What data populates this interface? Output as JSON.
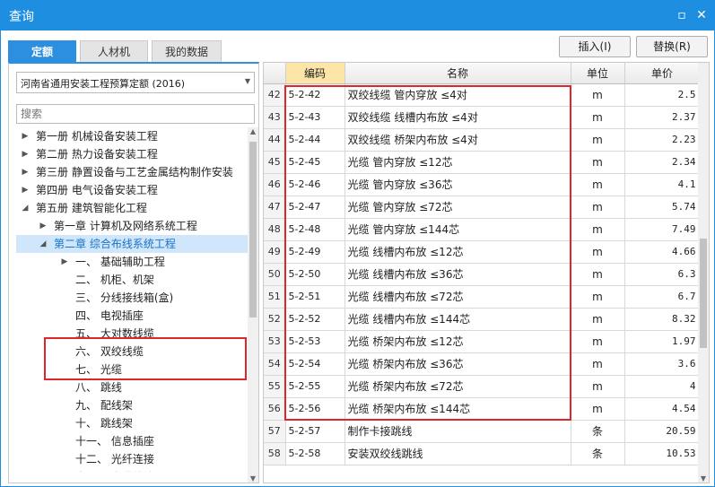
{
  "window": {
    "title": "查询"
  },
  "tabs": [
    {
      "label": "定额",
      "active": true
    },
    {
      "label": "人材机",
      "active": false
    },
    {
      "label": "我的数据",
      "active": false
    }
  ],
  "toolbar": {
    "insert_label": "插入(I)",
    "replace_label": "替换(R)"
  },
  "left": {
    "quota_select": "河南省通用安装工程预算定额 (2016)",
    "search_placeholder": "搜索",
    "tree": [
      {
        "label": "第一册  机械设备安装工程",
        "level": 0,
        "arrow": "right"
      },
      {
        "label": "第二册  热力设备安装工程",
        "level": 0,
        "arrow": "right"
      },
      {
        "label": "第三册  静置设备与工艺金属结构制作安装",
        "level": 0,
        "arrow": "right"
      },
      {
        "label": "第四册  电气设备安装工程",
        "level": 0,
        "arrow": "right"
      },
      {
        "label": "第五册  建筑智能化工程",
        "level": 0,
        "arrow": "down"
      },
      {
        "label": "第一章  计算机及网络系统工程",
        "level": 1,
        "arrow": "right"
      },
      {
        "label": "第二章  综合布线系统工程",
        "level": 1,
        "arrow": "down",
        "selected": true
      },
      {
        "label": "一、  基础辅助工程",
        "level": 2,
        "arrow": "right"
      },
      {
        "label": "二、  机柜、机架",
        "level": 2,
        "arrow": ""
      },
      {
        "label": "三、  分线接线箱(盒)",
        "level": 2,
        "arrow": ""
      },
      {
        "label": "四、  电视插座",
        "level": 2,
        "arrow": ""
      },
      {
        "label": "五、  大对数线缆",
        "level": 2,
        "arrow": ""
      },
      {
        "label": "六、  双绞线缆",
        "level": 2,
        "arrow": ""
      },
      {
        "label": "七、  光缆",
        "level": 2,
        "arrow": ""
      },
      {
        "label": "八、  跳线",
        "level": 2,
        "arrow": ""
      },
      {
        "label": "九、  配线架",
        "level": 2,
        "arrow": ""
      },
      {
        "label": "十、  跳线架",
        "level": 2,
        "arrow": ""
      },
      {
        "label": "十一、  信息插座",
        "level": 2,
        "arrow": ""
      },
      {
        "label": "十二、  光纤连接",
        "level": 2,
        "arrow": ""
      },
      {
        "label": "十三、  光缆终端盒",
        "level": 2,
        "arrow": ""
      }
    ]
  },
  "grid": {
    "columns": [
      "编码",
      "名称",
      "单位",
      "单价"
    ],
    "rows": [
      {
        "idx": "42",
        "code": "5-2-42",
        "name": "双绞线缆  管内穿放  ≤4对",
        "unit": "m",
        "price": "2.5"
      },
      {
        "idx": "43",
        "code": "5-2-43",
        "name": "双绞线缆  线槽内布放  ≤4对",
        "unit": "m",
        "price": "2.37"
      },
      {
        "idx": "44",
        "code": "5-2-44",
        "name": "双绞线缆  桥架内布放  ≤4对",
        "unit": "m",
        "price": "2.23"
      },
      {
        "idx": "45",
        "code": "5-2-45",
        "name": "光缆  管内穿放  ≤12芯",
        "unit": "m",
        "price": "2.34"
      },
      {
        "idx": "46",
        "code": "5-2-46",
        "name": "光缆  管内穿放  ≤36芯",
        "unit": "m",
        "price": "4.1"
      },
      {
        "idx": "47",
        "code": "5-2-47",
        "name": "光缆  管内穿放  ≤72芯",
        "unit": "m",
        "price": "5.74"
      },
      {
        "idx": "48",
        "code": "5-2-48",
        "name": "光缆  管内穿放  ≤144芯",
        "unit": "m",
        "price": "7.49"
      },
      {
        "idx": "49",
        "code": "5-2-49",
        "name": "光缆  线槽内布放  ≤12芯",
        "unit": "m",
        "price": "4.66"
      },
      {
        "idx": "50",
        "code": "5-2-50",
        "name": "光缆  线槽内布放  ≤36芯",
        "unit": "m",
        "price": "6.3"
      },
      {
        "idx": "51",
        "code": "5-2-51",
        "name": "光缆  线槽内布放  ≤72芯",
        "unit": "m",
        "price": "6.7"
      },
      {
        "idx": "52",
        "code": "5-2-52",
        "name": "光缆  线槽内布放  ≤144芯",
        "unit": "m",
        "price": "8.32"
      },
      {
        "idx": "53",
        "code": "5-2-53",
        "name": "光缆  桥架内布放  ≤12芯",
        "unit": "m",
        "price": "1.97"
      },
      {
        "idx": "54",
        "code": "5-2-54",
        "name": "光缆  桥架内布放  ≤36芯",
        "unit": "m",
        "price": "3.6"
      },
      {
        "idx": "55",
        "code": "5-2-55",
        "name": "光缆  桥架内布放  ≤72芯",
        "unit": "m",
        "price": "4"
      },
      {
        "idx": "56",
        "code": "5-2-56",
        "name": "光缆  桥架内布放  ≤144芯",
        "unit": "m",
        "price": "4.54"
      },
      {
        "idx": "57",
        "code": "5-2-57",
        "name": "制作卡接跳线",
        "unit": "条",
        "price": "20.59"
      },
      {
        "idx": "58",
        "code": "5-2-58",
        "name": "安装双绞线跳线",
        "unit": "条",
        "price": "10.53"
      }
    ]
  },
  "colors": {
    "titlebar": "#1e8fe0",
    "highlight_box": "#e0262b",
    "selected_node": "#cfe6fb"
  },
  "icons": {
    "minimize": "restore-icon",
    "close": "close-icon"
  }
}
